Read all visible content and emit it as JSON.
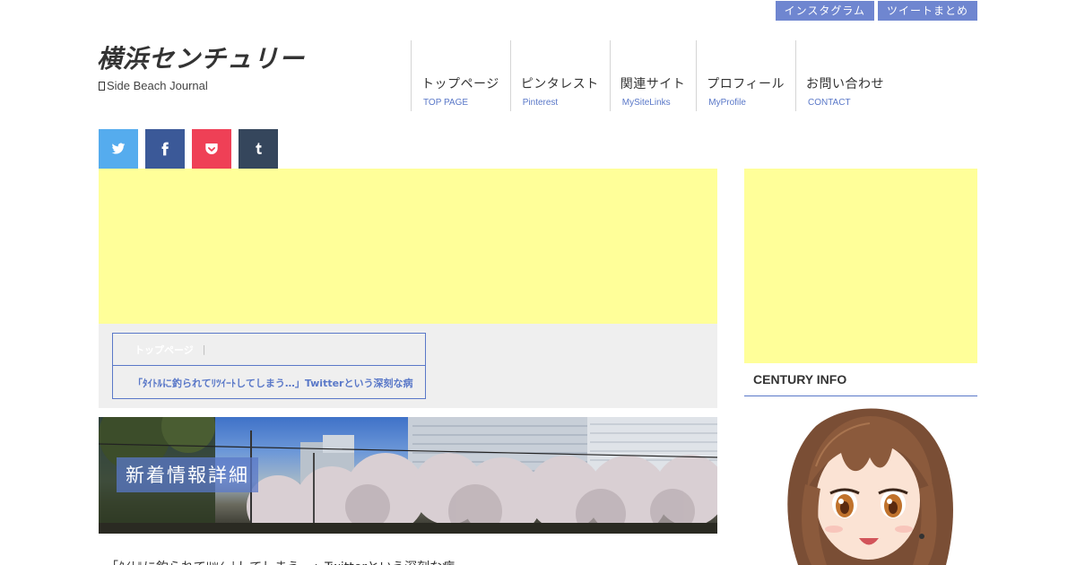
{
  "top_links": [
    "インスタグラム",
    "ツイートまとめ"
  ],
  "site": {
    "title": "横浜センチュリー",
    "subtitle": "Side Beach Journal"
  },
  "nav": [
    {
      "label": "トップページ",
      "sub": "TOP PAGE"
    },
    {
      "label": "ピンタレスト",
      "sub": "Pinterest"
    },
    {
      "label": "関連サイト",
      "sub": "MySiteLinks"
    },
    {
      "label": "プロフィール",
      "sub": "MyProfile"
    },
    {
      "label": "お問い合わせ",
      "sub": "CONTACT"
    }
  ],
  "share": [
    {
      "icon": "twitter-icon",
      "color": "#55acee"
    },
    {
      "icon": "facebook-icon",
      "color": "#3b5998"
    },
    {
      "icon": "pocket-icon",
      "color": "#ef4056"
    },
    {
      "icon": "tumblr-icon",
      "color": "#35465c"
    }
  ],
  "breadcrumb": {
    "home": "トップページ",
    "separator": "|",
    "current": "「ﾀｲﾄﾙに釣られてﾘﾂｲｰﾄしてしまう…」Twitterという深刻な病"
  },
  "hero": {
    "label": "新着情報詳細"
  },
  "article": {
    "title": "「ﾀｲﾄﾙに釣られてﾘﾂｲｰﾄしてしまう…」Twitterという深刻な病"
  },
  "sidebar": {
    "heading": "CENTURY INFO"
  },
  "colors": {
    "accent": "#5a78c8",
    "ad_placeholder": "#ffff99",
    "breadcrumb_bg": "#efefef"
  }
}
